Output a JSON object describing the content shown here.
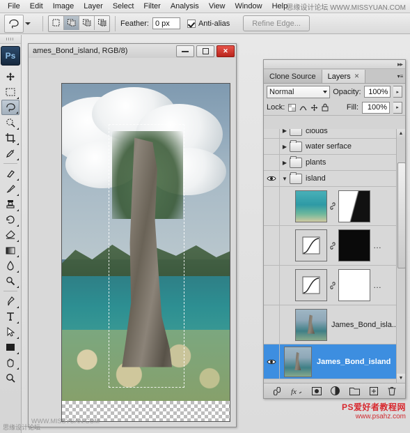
{
  "menubar": {
    "items": [
      "File",
      "Edit",
      "Image",
      "Layer",
      "Select",
      "Filter",
      "Analysis",
      "View",
      "Window",
      "Help"
    ],
    "watermark": "思缘设计论坛 WWW.MISSYUAN.COM"
  },
  "options_bar": {
    "tool_preset_icon": "lasso-tool-icon",
    "selection_modes": [
      "new-selection",
      "add-to-selection",
      "subtract-from-selection",
      "intersect-selection"
    ],
    "feather_label": "Feather:",
    "feather_value": "0 px",
    "antialias_label": "Anti-alias",
    "antialias_checked": true,
    "refine_edge_label": "Refine Edge..."
  },
  "toolbar": {
    "badge": "Ps",
    "tools": [
      "move-tool",
      "marquee-tool",
      "lasso-tool",
      "quick-selection-tool",
      "crop-tool",
      "eyedropper-tool",
      "healing-brush-tool",
      "brush-tool",
      "clone-stamp-tool",
      "history-brush-tool",
      "eraser-tool",
      "gradient-tool",
      "blur-tool",
      "dodge-tool",
      "pen-tool",
      "type-tool",
      "path-selection-tool",
      "shape-tool",
      "hand-tool",
      "zoom-tool"
    ],
    "selected_tool": "lasso-tool"
  },
  "document": {
    "title": "ames_Bond_island, RGB/8)",
    "window_buttons": [
      "minimize",
      "maximize",
      "close"
    ],
    "watermark": "WWW.MISSYUAN.COM"
  },
  "panel": {
    "tabs": [
      {
        "label": "Clone Source",
        "active": false,
        "closable": false
      },
      {
        "label": "Layers",
        "active": true,
        "closable": true
      }
    ],
    "blend_mode": "Normal",
    "opacity_label": "Opacity:",
    "opacity_value": "100%",
    "lock_label": "Lock:",
    "fill_label": "Fill:",
    "fill_value": "100%",
    "layers": [
      {
        "name": "clouds",
        "type": "group",
        "visible": false,
        "expanded": false,
        "selected": false
      },
      {
        "name": "water serface",
        "type": "group",
        "visible": false,
        "expanded": false,
        "selected": false
      },
      {
        "name": "plants",
        "type": "group",
        "visible": false,
        "expanded": false,
        "selected": false
      },
      {
        "name": "island",
        "type": "group",
        "visible": true,
        "expanded": true,
        "selected": false
      },
      {
        "name": "",
        "type": "image-with-mask",
        "visible": false,
        "selected": false
      },
      {
        "name": "",
        "type": "adjustment-black-mask",
        "visible": false,
        "selected": false
      },
      {
        "name": "",
        "type": "adjustment-white-mask",
        "visible": false,
        "selected": false
      },
      {
        "name": "James_Bond_isla...",
        "type": "image",
        "visible": false,
        "selected": false
      },
      {
        "name": "James_Bond_island",
        "type": "image",
        "visible": true,
        "selected": true
      }
    ],
    "footer_buttons": [
      "link-layers",
      "layer-style",
      "add-layer-mask",
      "new-adjustment-layer",
      "new-group",
      "new-layer",
      "delete-layer"
    ]
  },
  "watermarks": {
    "bottom_right_main": "PS爱好者教程网",
    "bottom_right_sub": "www.psahz.com",
    "bottom_left": "思缘设计论坛"
  }
}
